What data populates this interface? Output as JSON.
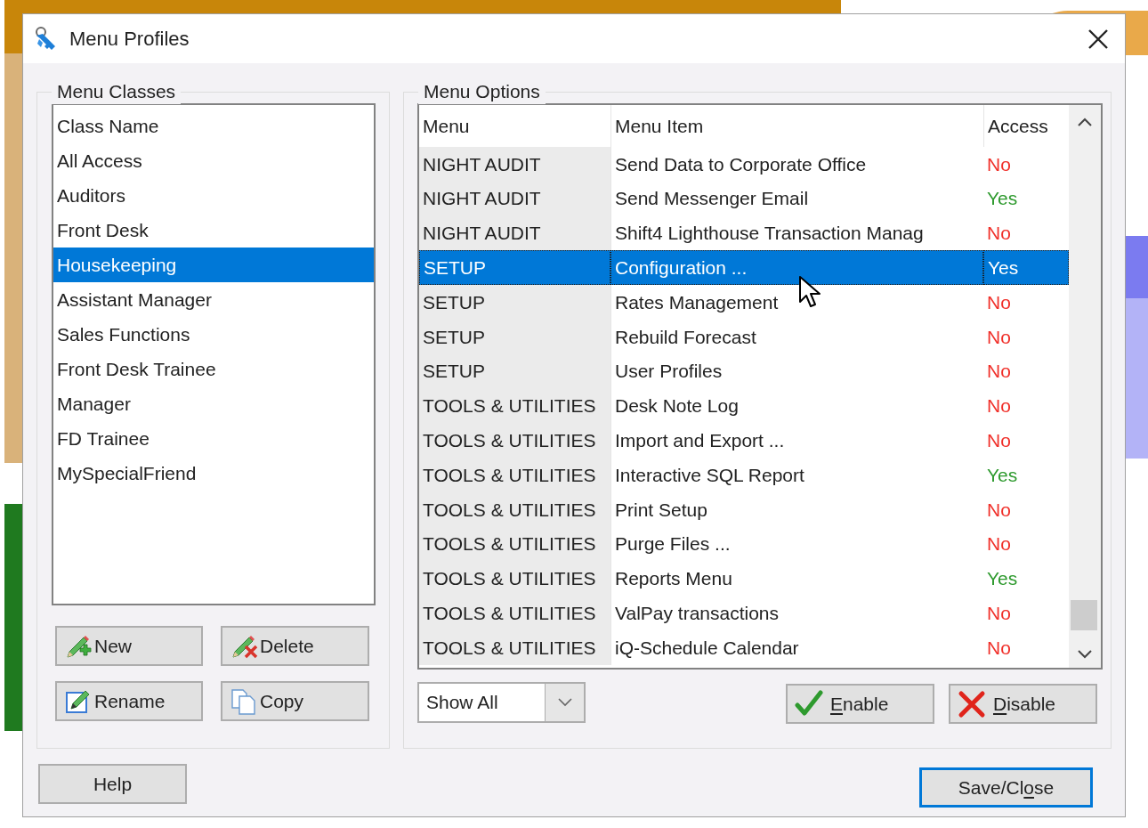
{
  "window": {
    "title": "Menu Profiles"
  },
  "menu_classes": {
    "title": "Menu Classes",
    "list_header": "Class Name",
    "items": [
      {
        "label": "All Access",
        "selected": false
      },
      {
        "label": "Auditors",
        "selected": false
      },
      {
        "label": "Front Desk",
        "selected": false
      },
      {
        "label": "Housekeeping",
        "selected": true
      },
      {
        "label": "Assistant Manager",
        "selected": false
      },
      {
        "label": "Sales Functions",
        "selected": false
      },
      {
        "label": "Front Desk Trainee",
        "selected": false
      },
      {
        "label": "Manager",
        "selected": false
      },
      {
        "label": "FD Trainee",
        "selected": false
      },
      {
        "label": "MySpecialFriend",
        "selected": false
      }
    ],
    "buttons": [
      {
        "kind": "new",
        "label": "New"
      },
      {
        "kind": "delete",
        "label": "Delete"
      },
      {
        "kind": "rename",
        "label": "Rename"
      },
      {
        "kind": "copy",
        "label": "Copy"
      }
    ]
  },
  "menu_options": {
    "title": "Menu Options",
    "columns": [
      "Menu",
      "Menu Item",
      "Access"
    ],
    "rows": [
      {
        "menu": "NIGHT AUDIT",
        "item": "Send Data to Corporate Office",
        "access": "No",
        "allowed": false,
        "selected": false
      },
      {
        "menu": "NIGHT AUDIT",
        "item": "Send Messenger Email",
        "access": "Yes",
        "allowed": true,
        "selected": false
      },
      {
        "menu": "NIGHT AUDIT",
        "item": "Shift4 Lighthouse Transaction Manag",
        "access": "No",
        "allowed": false,
        "selected": false
      },
      {
        "menu": "SETUP",
        "item": "Configuration ...",
        "access": "Yes",
        "selected": true
      },
      {
        "menu": "SETUP",
        "item": "Rates Management",
        "access": "No",
        "allowed": false,
        "selected": false
      },
      {
        "menu": "SETUP",
        "item": "Rebuild Forecast",
        "access": "No",
        "allowed": false,
        "selected": false
      },
      {
        "menu": "SETUP",
        "item": "User Profiles",
        "access": "No",
        "allowed": false,
        "selected": false
      },
      {
        "menu": "TOOLS & UTILITIES",
        "item": "Desk Note Log",
        "access": "No",
        "allowed": false,
        "selected": false
      },
      {
        "menu": "TOOLS & UTILITIES",
        "item": "Import and Export ...",
        "access": "No",
        "allowed": false,
        "selected": false
      },
      {
        "menu": "TOOLS & UTILITIES",
        "item": "Interactive SQL Report",
        "access": "Yes",
        "allowed": true,
        "selected": false
      },
      {
        "menu": "TOOLS & UTILITIES",
        "item": "Print Setup",
        "access": "No",
        "allowed": false,
        "selected": false
      },
      {
        "menu": "TOOLS & UTILITIES",
        "item": "Purge Files ...",
        "access": "No",
        "allowed": false,
        "selected": false
      },
      {
        "menu": "TOOLS & UTILITIES",
        "item": "Reports Menu",
        "access": "Yes",
        "allowed": true,
        "selected": false
      },
      {
        "menu": "TOOLS & UTILITIES",
        "item": "ValPay transactions",
        "access": "No",
        "allowed": false,
        "selected": false
      },
      {
        "menu": "TOOLS & UTILITIES",
        "item": "iQ-Schedule Calendar",
        "access": "No",
        "allowed": false,
        "selected": false
      }
    ],
    "filter": {
      "value": "Show All"
    },
    "buttons": [
      {
        "kind": "enable",
        "label": [
          {
            "text": "E",
            "access_key": true
          },
          {
            "text": "nable",
            "access_key": false
          }
        ]
      },
      {
        "kind": "disable",
        "label": [
          {
            "text": "D",
            "access_key": true
          },
          {
            "text": "isable",
            "access_key": false
          }
        ]
      }
    ]
  },
  "footer_buttons": [
    {
      "kind": "help",
      "label": "Help",
      "default": false
    },
    {
      "kind": "save",
      "label": [
        {
          "text": "Save/Cl",
          "access_key": false
        },
        {
          "text": "o",
          "access_key": true
        },
        {
          "text": "se",
          "access_key": false
        }
      ],
      "default": true
    }
  ]
}
